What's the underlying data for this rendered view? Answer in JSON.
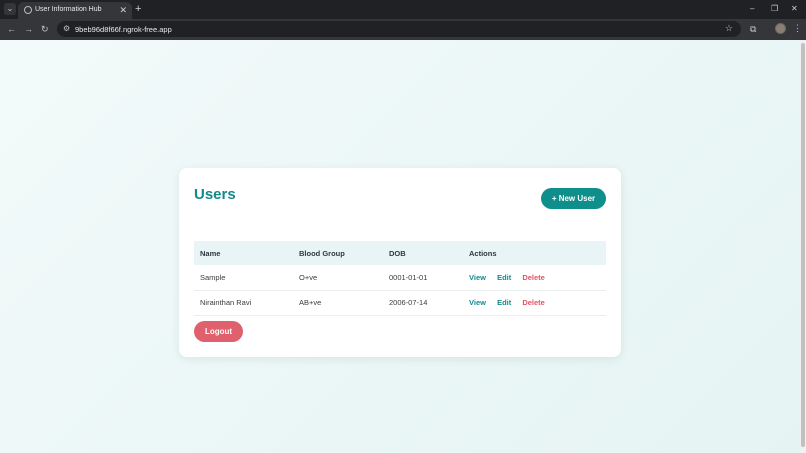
{
  "browser": {
    "tab_title": "User Information Hub",
    "tab_close": "✕",
    "new_tab": "+",
    "url": "9beb96d8f66f.ngrok-free.app",
    "controls": {
      "minimize": "–",
      "restore": "❐",
      "close": "✕"
    },
    "nav": {
      "back": "←",
      "forward": "→",
      "reload": "↻"
    }
  },
  "page": {
    "title": "Users",
    "new_user_label": "+ New User",
    "logout_label": "Logout",
    "table": {
      "headers": [
        "Name",
        "Blood Group",
        "DOB",
        "Actions"
      ],
      "rows": [
        {
          "name": "Sample",
          "blood_group": "O+ve",
          "dob": "0001-01-01"
        },
        {
          "name": "Nirainthan Ravi",
          "blood_group": "AB+ve",
          "dob": "2006-07-14"
        }
      ],
      "actions": {
        "view": "View",
        "edit": "Edit",
        "delete": "Delete"
      }
    }
  },
  "colors": {
    "accent": "#0e8f8c",
    "danger": "#e0606d",
    "title": "#138a8a"
  }
}
